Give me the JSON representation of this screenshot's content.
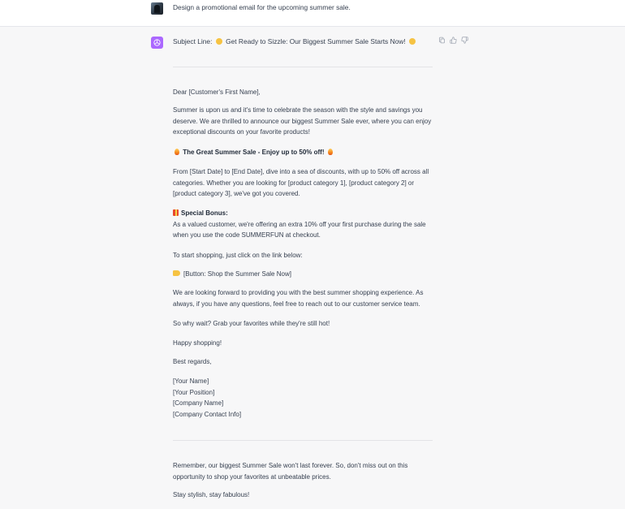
{
  "user_message": {
    "text": "Design a promotional email for the upcoming summer sale."
  },
  "assistant": {
    "subject_prefix": "Subject Line:",
    "subject_text": "Get Ready to Sizzle: Our Biggest Summer Sale Starts Now!",
    "greeting": "Dear [Customer's First Name],",
    "intro_1": "Summer is upon us and it's time to celebrate the season with the style and savings you",
    "intro_2": "deserve. We are thrilled to announce our biggest Summer Sale ever, where you can enjoy",
    "intro_3": "exceptional discounts on your favorite products!",
    "headline": "The Great Summer Sale - Enjoy up to 50% off!",
    "dates_1": "From [Start Date] to [End Date], dive into a sea of discounts, with up to 50% off across all",
    "dates_2": "categories. Whether you are looking for [product category 1], [product category 2] or",
    "dates_3": "[product category 3], we've got you covered.",
    "bonus_title": "Special Bonus:",
    "bonus_1": "As a valued customer, we're offering an extra 10% off your first purchase during the sale",
    "bonus_2": "when you use the code SUMMERFUN at checkout.",
    "start_shopping": "To start shopping, just click on the link below:",
    "button_text": "[Button: Shop the Summer Sale Now]",
    "forward_1": "We are looking forward to providing you with the best summer shopping experience. As",
    "forward_2": "always, if you have any questions, feel free to reach out to our customer service team.",
    "so_why": "So why wait? Grab your favorites while they're still hot!",
    "happy": "Happy shopping!",
    "regards": "Best regards,",
    "sig_name": "[Your Name]",
    "sig_position": "[Your Position]",
    "sig_company": "[Company Name]",
    "sig_contact": "[Company Contact Info]",
    "remember_1": "Remember, our biggest Summer Sale won't last forever. So, don't miss out on this",
    "remember_2": "opportunity to shop your favorites at unbeatable prices.",
    "stay": "Stay stylish, stay fabulous!"
  },
  "colors": {
    "assistant_bg": "#f7f7f8",
    "avatar_purple": "#ab68ff",
    "text": "#374151"
  },
  "icons": [
    "user-avatar",
    "chatgpt-logo-icon",
    "copy-icon",
    "thumbs-up-icon",
    "thumbs-down-icon",
    "sun-emoji",
    "fire-emoji",
    "gift-emoji",
    "pointing-hand-emoji"
  ]
}
